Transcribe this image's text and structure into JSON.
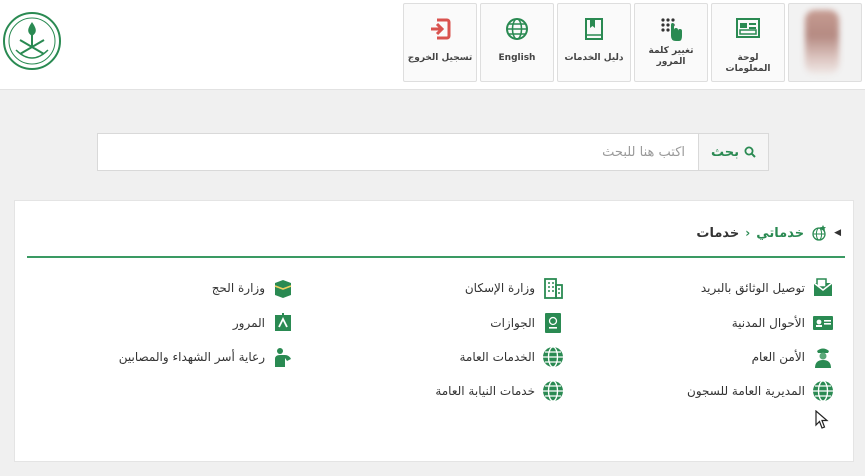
{
  "toolbar": {
    "dashboard": "لوحة المعلومات",
    "change_password": "تغيير كلمة المرور",
    "services_guide": "دليل الخدمات",
    "language": "English",
    "logout": "تسجيل الخروج"
  },
  "search": {
    "placeholder": "اكتب هنا للبحث",
    "button_label": "بحث"
  },
  "breadcrumb": {
    "home": "خدماتي",
    "current": "خدمات"
  },
  "services": {
    "col_right": [
      "توصيل الوثائق بالبريد",
      "الأحوال المدنية",
      "الأمن العام",
      "المديرية العامة للسجون"
    ],
    "col_middle": [
      "وزارة الإسكان",
      "الجوازات",
      "الخدمات العامة",
      "خدمات النيابة العامة"
    ],
    "col_left": [
      "وزارة الحج",
      "المرور",
      "رعاية أسر الشهداء والمصابين"
    ]
  },
  "colors": {
    "brand_green": "#2a8a52",
    "logout_red": "#d9534f"
  },
  "icons": {
    "dashboard": "dashboard-icon",
    "change_password": "keypad-hand-icon",
    "services_guide": "book-icon",
    "language": "globe-icon",
    "logout": "sign-out-icon",
    "search": "search-icon"
  }
}
